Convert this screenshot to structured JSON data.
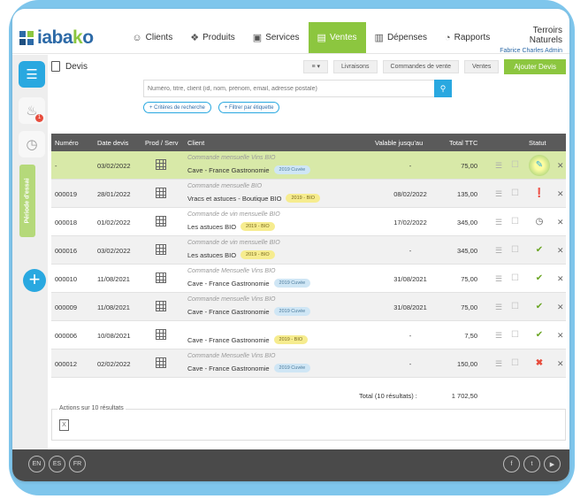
{
  "brand": {
    "logo_text_main": "iaba",
    "logo_text_x": "k",
    "logo_text_end": "o"
  },
  "nav": [
    {
      "label": "Clients",
      "icon": "user-icon",
      "glyph": "☺"
    },
    {
      "label": "Produits",
      "icon": "tag-icon",
      "glyph": "❖"
    },
    {
      "label": "Services",
      "icon": "briefcase-icon",
      "glyph": "▣"
    },
    {
      "label": "Ventes",
      "icon": "register-icon",
      "glyph": "▤",
      "active": true
    },
    {
      "label": "Dépenses",
      "icon": "receipt-icon",
      "glyph": "▥"
    },
    {
      "label": "Rapports",
      "icon": "pie-chart-icon",
      "glyph": "◔"
    }
  ],
  "account": {
    "company": "Terroirs Naturels",
    "user": "Fabrice Charles Admin"
  },
  "rail": {
    "badge_count": "1",
    "trial_label": "Période d'essai"
  },
  "toolbar": {
    "title": "Devis",
    "menu_glyph": "≡ ▾",
    "livraisons": "Livraisons",
    "commandes": "Commandes de vente",
    "ventes": "Ventes",
    "add": "Ajouter Devis"
  },
  "search": {
    "placeholder": "Numéro, titre, client (id, nom, prénom, email, adresse postale)",
    "criteria": "+ Critères de recherche",
    "tag_filter": "+ Filtrer par étiquette"
  },
  "table": {
    "headers": {
      "number": "Numéro",
      "date": "Date devis",
      "prod": "Prod / Serv",
      "client": "Client",
      "valid": "Valable jusqu'au",
      "ttc": "Total TTC",
      "status": "Statut"
    },
    "rows": [
      {
        "number": "-",
        "date": "03/02/2022",
        "subtitle": "Commande mensuelle Vins BIO",
        "client": "Cave - France Gastronomie",
        "tag": "2019 Cuvée",
        "tag_color": "blue",
        "valid": "-",
        "ttc": "75,00",
        "status": "edit"
      },
      {
        "number": "000019",
        "date": "28/01/2022",
        "subtitle": "Commande mensuelle BIO",
        "client": "Vracs et astuces - Boutique BIO",
        "tag": "2019 - BIO",
        "tag_color": "yellow",
        "valid": "08/02/2022",
        "ttc": "135,00",
        "status": "warning"
      },
      {
        "number": "000018",
        "date": "01/02/2022",
        "subtitle": "Commande de vin mensuelle BIO",
        "client": "Les astuces BIO",
        "tag": "2019 - BIO",
        "tag_color": "yellow",
        "valid": "17/02/2022",
        "ttc": "345,00",
        "status": "pending"
      },
      {
        "number": "000016",
        "date": "03/02/2022",
        "subtitle": "Commande de vin mensuelle BIO",
        "client": "Les astuces BIO",
        "tag": "2019 - BIO",
        "tag_color": "yellow",
        "valid": "-",
        "ttc": "345,00",
        "status": "accepted"
      },
      {
        "number": "000010",
        "date": "11/08/2021",
        "subtitle": "Commande Mensuelle Vins BIO",
        "client": "Cave - France Gastronomie",
        "tag": "2019 Cuvée",
        "tag_color": "blue",
        "valid": "31/08/2021",
        "ttc": "75,00",
        "status": "accepted"
      },
      {
        "number": "000009",
        "date": "11/08/2021",
        "subtitle": "Commande mensuelle Vins BIO",
        "client": "Cave - France Gastronomie",
        "tag": "2019 Cuvée",
        "tag_color": "blue",
        "valid": "31/08/2021",
        "ttc": "75,00",
        "status": "accepted"
      },
      {
        "number": "000006",
        "date": "10/08/2021",
        "subtitle": "",
        "client": "Cave - France Gastronomie",
        "tag": "2019 - BIO",
        "tag_color": "yellow",
        "valid": "-",
        "ttc": "7,50",
        "status": "accepted"
      },
      {
        "number": "000012",
        "date": "02/02/2022",
        "subtitle": "Commande Mensuelle Vins BIO",
        "client": "Cave - France Gastronomie",
        "tag": "2019 Cuvée",
        "tag_color": "blue",
        "valid": "-",
        "ttc": "150,00",
        "status": "refused"
      }
    ],
    "total_label": "Total (10 résultats) :",
    "total_value": "1 702,50"
  },
  "actions": {
    "legend": "Actions sur 10 résultats",
    "excel_glyph": "X"
  },
  "footer": {
    "langs": [
      "EN",
      "ES",
      "FR"
    ],
    "socials": [
      "facebook-icon",
      "twitter-icon",
      "youtube-icon"
    ],
    "social_glyphs": [
      "f",
      "t",
      "▶"
    ]
  },
  "colors": {
    "accent_green": "#8cc63f",
    "accent_blue": "#29a8e0",
    "brand_blue": "#2d6aa7",
    "header_dark": "#5a5a5a",
    "footer_dark": "#4a4a4a"
  }
}
